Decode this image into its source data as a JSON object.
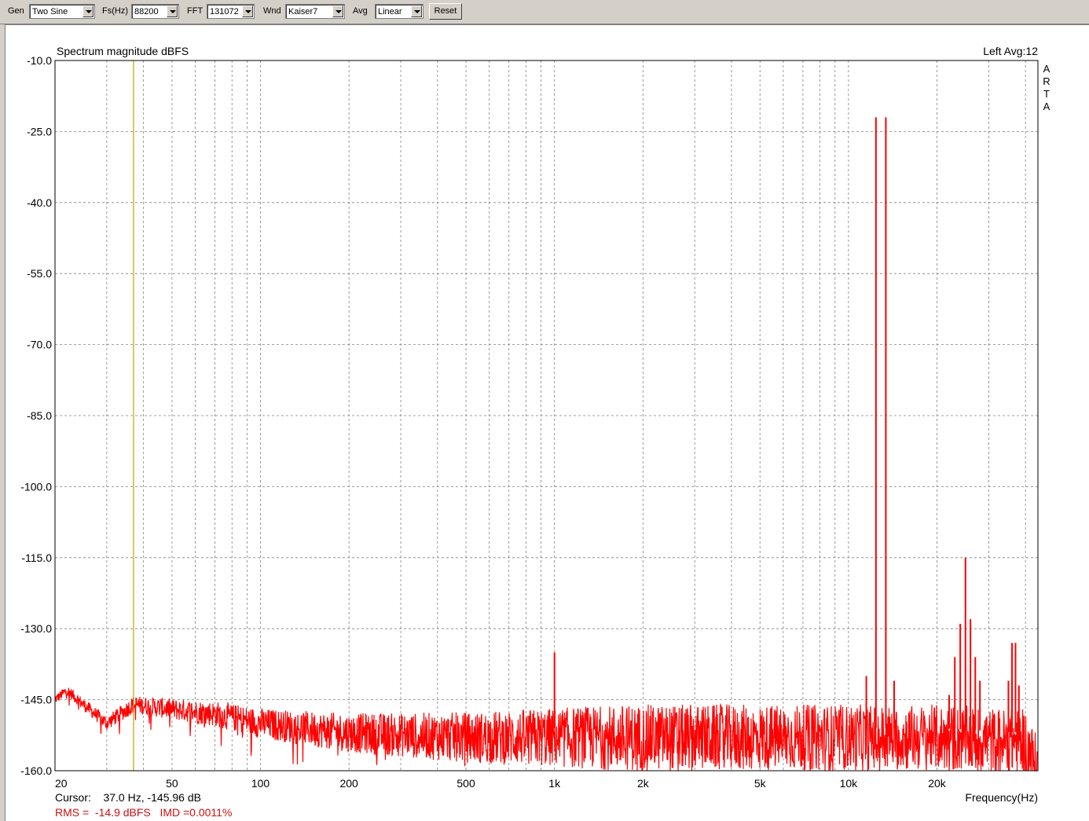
{
  "toolbar": {
    "gen_label": "Gen",
    "gen_value": "Two Sine",
    "fs_label": "Fs(Hz)",
    "fs_value": "88200",
    "fft_label": "FFT",
    "fft_value": "131072",
    "wnd_label": "Wnd",
    "wnd_value": "Kaiser7",
    "avg_label": "Avg",
    "avg_value": "Linear",
    "reset_label": "Reset"
  },
  "chart": {
    "title": "Spectrum magnitude dBFS",
    "channel_info": "Left  Avg:12",
    "watermark": [
      "A",
      "R",
      "T",
      "A"
    ],
    "xlabel": "Frequency(Hz)",
    "cursor_text": "Cursor:    37.0 Hz, -145.96 dB",
    "rms_text": "RMS =  -14.9 dBFS   IMD =0.0011%"
  },
  "colors": {
    "trace": "#ff0000",
    "cursor": "#c8a000",
    "grid": "#808080"
  },
  "chart_data": {
    "type": "line",
    "title": "Spectrum magnitude dBFS",
    "xlabel": "Frequency(Hz)",
    "ylabel": "",
    "x_scale": "log",
    "xlim": [
      20,
      44100
    ],
    "ylim": [
      -160,
      -10
    ],
    "x_tick_labels": [
      {
        "value": 20,
        "label": "20"
      },
      {
        "value": 50,
        "label": "50"
      },
      {
        "value": 100,
        "label": "100"
      },
      {
        "value": 200,
        "label": "200"
      },
      {
        "value": 500,
        "label": "500"
      },
      {
        "value": 1000,
        "label": "1k"
      },
      {
        "value": 2000,
        "label": "2k"
      },
      {
        "value": 5000,
        "label": "5k"
      },
      {
        "value": 10000,
        "label": "10k"
      },
      {
        "value": 20000,
        "label": "20k"
      }
    ],
    "y_ticks": [
      -10,
      -25,
      -40,
      -55,
      -70,
      -85,
      -100,
      -115,
      -130,
      -145,
      -160
    ],
    "y_tick_labels": [
      "-10.0",
      "-25.0",
      "-40.0",
      "-55.0",
      "-70.0",
      "-85.0",
      "-100.0",
      "-115.0",
      "-130.0",
      "-145.0",
      "-160.0"
    ],
    "cursor": {
      "x": 37.0,
      "y": -145.96
    },
    "noise_floor": [
      [
        20,
        -145
      ],
      [
        22,
        -143
      ],
      [
        25,
        -146
      ],
      [
        30,
        -150
      ],
      [
        37,
        -146
      ],
      [
        50,
        -147
      ],
      [
        70,
        -148
      ],
      [
        100,
        -150
      ],
      [
        200,
        -152
      ],
      [
        500,
        -153
      ],
      [
        1000,
        -153
      ],
      [
        2000,
        -153
      ],
      [
        5000,
        -153
      ],
      [
        10000,
        -153
      ],
      [
        20000,
        -153
      ],
      [
        40000,
        -154
      ],
      [
        44000,
        -160
      ]
    ],
    "peaks": [
      {
        "x": 1000,
        "y": -135
      },
      {
        "x": 11500,
        "y": -140
      },
      {
        "x": 12400,
        "y": -22
      },
      {
        "x": 13400,
        "y": -22
      },
      {
        "x": 14300,
        "y": -141
      },
      {
        "x": 22000,
        "y": -144
      },
      {
        "x": 23000,
        "y": -136
      },
      {
        "x": 24000,
        "y": -129
      },
      {
        "x": 25000,
        "y": -115
      },
      {
        "x": 26000,
        "y": -128
      },
      {
        "x": 27000,
        "y": -136
      },
      {
        "x": 28000,
        "y": -141
      },
      {
        "x": 35000,
        "y": -141
      },
      {
        "x": 36000,
        "y": -133
      },
      {
        "x": 37000,
        "y": -133
      },
      {
        "x": 38000,
        "y": -142
      }
    ]
  }
}
